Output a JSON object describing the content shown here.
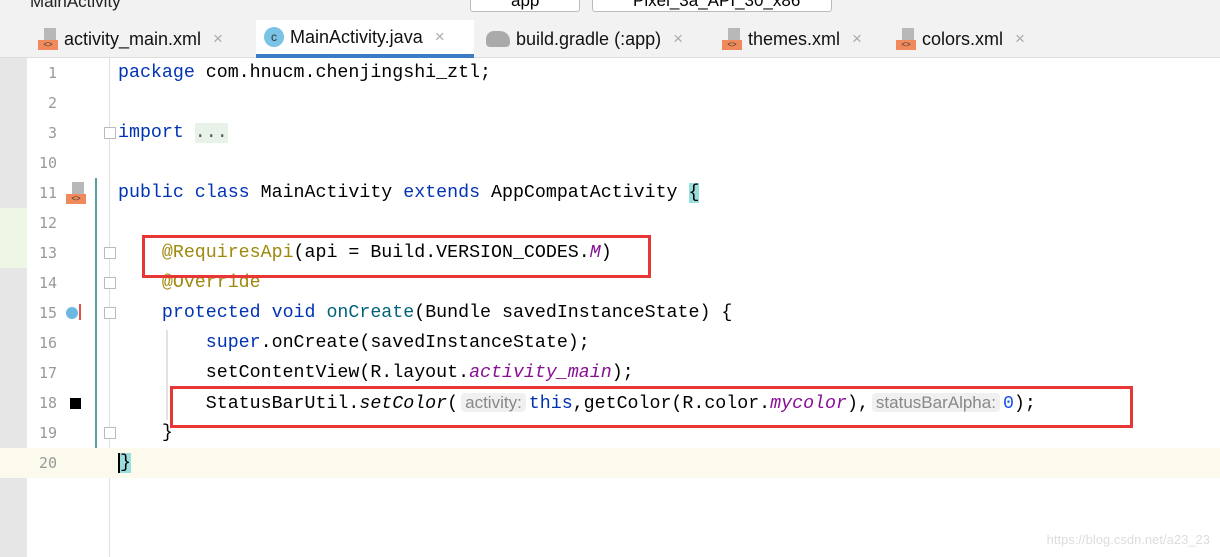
{
  "toolbar": {
    "project": "MainActivity",
    "config": "app",
    "device": "Pixel_3a_API_30_x86"
  },
  "tabs": [
    {
      "label": "activity_main.xml",
      "icon": "xml-file-icon"
    },
    {
      "label": "MainActivity.java",
      "icon": "java-class-icon",
      "active": true
    },
    {
      "label": "build.gradle (:app)",
      "icon": "gradle-icon"
    },
    {
      "label": "themes.xml",
      "icon": "xml-file-icon"
    },
    {
      "label": "colors.xml",
      "icon": "xml-file-icon"
    }
  ],
  "close_glyph": "×",
  "lines": [
    {
      "n": "1",
      "tokens": [
        [
          "kw",
          "package "
        ],
        [
          "",
          "com.hnucm.chenjingshi_ztl;"
        ]
      ]
    },
    {
      "n": "2",
      "tokens": []
    },
    {
      "n": "3",
      "tokens": [
        [
          "kw",
          "import "
        ],
        [
          "fold",
          "..."
        ]
      ]
    },
    {
      "n": "10",
      "tokens": []
    },
    {
      "n": "11",
      "tokens": [
        [
          "kw",
          "public class "
        ],
        [
          "",
          "MainActivity "
        ],
        [
          "kw",
          "extends "
        ],
        [
          "",
          "AppCompatActivity "
        ],
        [
          "brace",
          "{"
        ]
      ]
    },
    {
      "n": "12",
      "tokens": []
    },
    {
      "n": "13",
      "tokens": [
        [
          "",
          "    "
        ],
        [
          "ann",
          "@RequiresApi"
        ],
        [
          "",
          "(api = Build.VERSION_CODES."
        ],
        [
          "it",
          "M"
        ],
        [
          "",
          ")"
        ]
      ]
    },
    {
      "n": "14",
      "tokens": [
        [
          "",
          "    "
        ],
        [
          "ann",
          "@Override"
        ]
      ]
    },
    {
      "n": "15",
      "tokens": [
        [
          "",
          "    "
        ],
        [
          "kw",
          "protected void "
        ],
        [
          "fn",
          "onCreate"
        ],
        [
          "",
          "(Bundle savedInstanceState) {"
        ]
      ]
    },
    {
      "n": "16",
      "tokens": [
        [
          "",
          "        "
        ],
        [
          "kw",
          "super"
        ],
        [
          "",
          ".onCreate(savedInstanceState);"
        ]
      ]
    },
    {
      "n": "17",
      "tokens": [
        [
          "",
          "        setContentView(R.layout."
        ],
        [
          "it",
          "activity_main"
        ],
        [
          "",
          ");"
        ]
      ]
    },
    {
      "n": "18",
      "tokens": [
        [
          "",
          "        StatusBarUtil."
        ],
        [
          "iti",
          "setColor"
        ],
        [
          "",
          "("
        ],
        [
          "hint",
          "activity:"
        ],
        [
          "kw",
          "this"
        ],
        [
          "",
          ",getColor(R.color."
        ],
        [
          "it",
          "mycolor"
        ],
        [
          "",
          "),"
        ],
        [
          "hint",
          "statusBarAlpha:"
        ],
        [
          "num",
          "0"
        ],
        [
          "",
          ");"
        ]
      ]
    },
    {
      "n": "19",
      "tokens": [
        [
          "",
          "    }"
        ]
      ]
    },
    {
      "n": "20",
      "tokens": [
        [
          "brace cur",
          "}"
        ]
      ]
    }
  ],
  "watermark": "https://blog.csdn.net/a23_23",
  "colors": {
    "highlight_box": "#e83535",
    "active_tab": "#3c7bc6",
    "keyword": "#0033b3",
    "annotation": "#9e880d"
  }
}
